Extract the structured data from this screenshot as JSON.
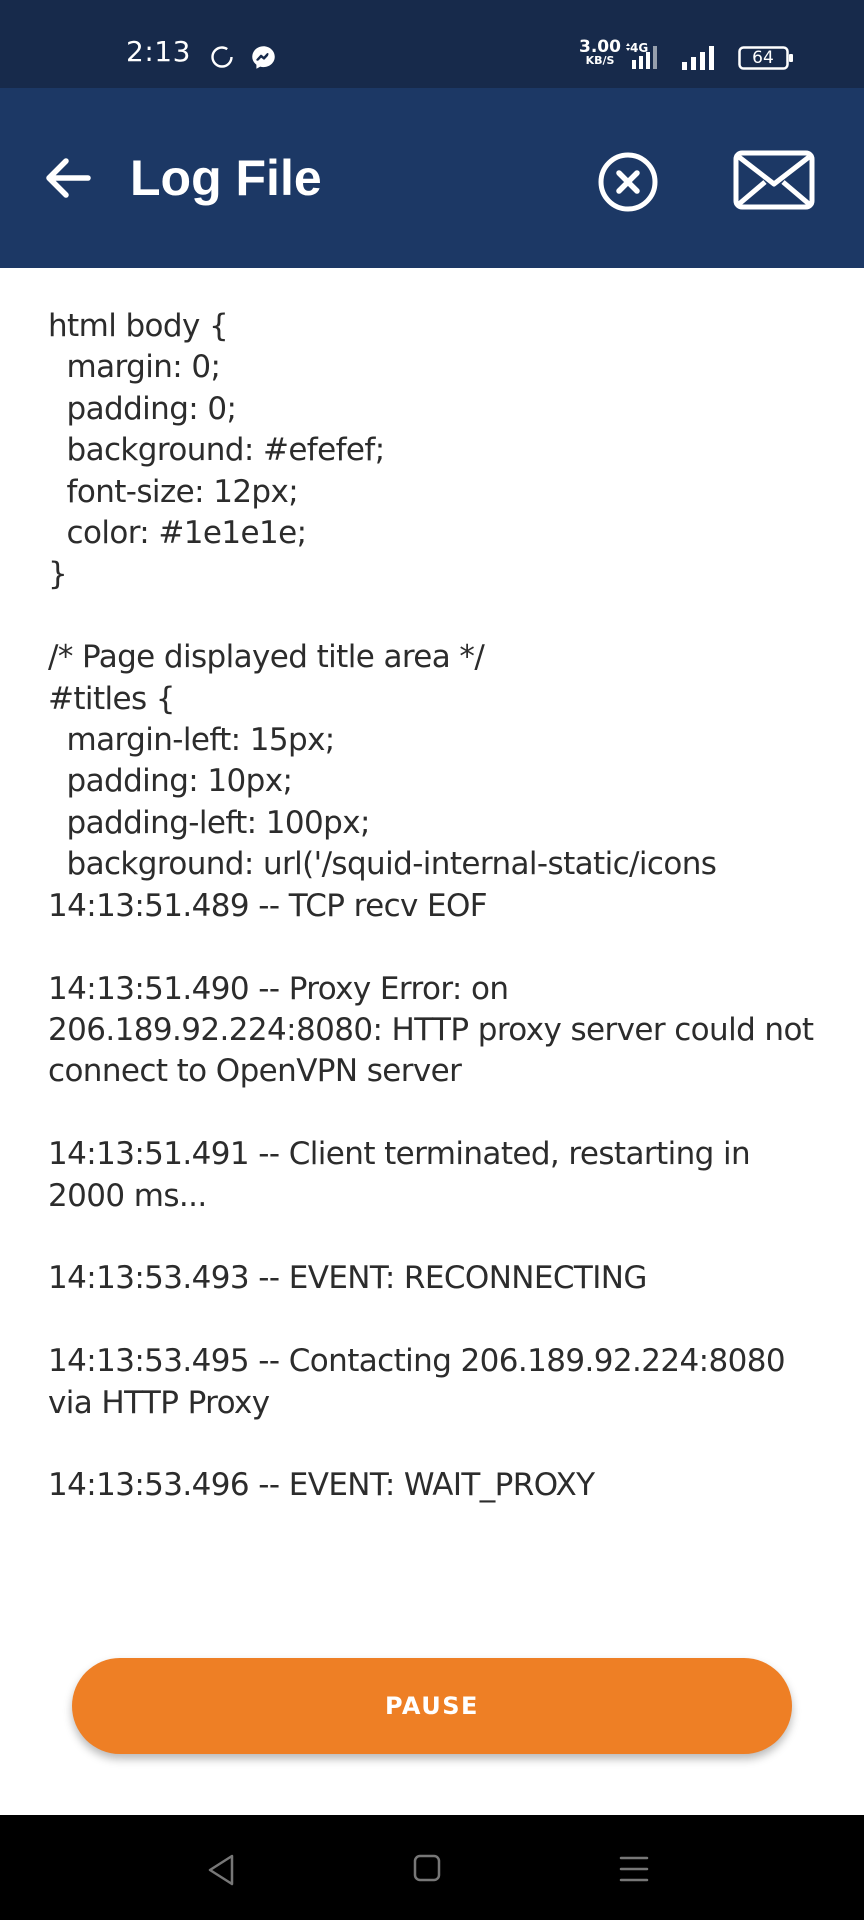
{
  "status_bar": {
    "time": "2:13",
    "net_speed_value": "3.00",
    "net_speed_unit": "KB/S",
    "network_type": "4G",
    "battery": "64"
  },
  "app_bar": {
    "title": "Log File",
    "icons": [
      "arrow-left-icon",
      "close-circle-icon",
      "mail-icon"
    ]
  },
  "log_text": "html body {\n  margin: 0;\n  padding: 0;\n  background: #efefef;\n  font-size: 12px;\n  color: #1e1e1e;\n}\n\n/* Page displayed title area */\n#titles {\n  margin-left: 15px;\n  padding: 10px;\n  padding-left: 100px;\n  background: url('/squid-internal-static/icons\n14:13:51.489 -- TCP recv EOF\n\n14:13:51.490 -- Proxy Error: on 206.189.92.224:8080: HTTP proxy server could not connect to OpenVPN server\n\n14:13:51.491 -- Client terminated, restarting in 2000 ms...\n\n14:13:53.493 -- EVENT: RECONNECTING\n\n14:13:53.495 -- Contacting 206.189.92.224:8080 via HTTP Proxy\n\n14:13:53.496 -- EVENT: WAIT_PROXY",
  "pause_button": {
    "label": "PAUSE"
  },
  "nav_bar": {
    "icons": [
      "nav-back-icon",
      "nav-home-icon",
      "nav-menu-icon"
    ]
  },
  "colors": {
    "status_bar": "#172a4b",
    "app_bar": "#1c3865",
    "accent": "#ee7f25",
    "text": "#2c2c2c",
    "nav_bar": "#000000"
  }
}
